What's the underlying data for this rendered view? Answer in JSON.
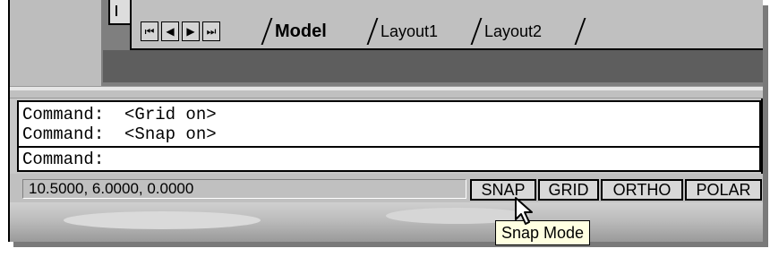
{
  "tabs": {
    "nav": [
      "⏮",
      "◀",
      "▶",
      "⏭"
    ],
    "items": [
      "Model",
      "Layout1",
      "Layout2"
    ],
    "active": "Model"
  },
  "command": {
    "lines": [
      "Command:  <Grid on>",
      "Command:  <Snap on>"
    ],
    "prompt": "Command:"
  },
  "status": {
    "coordinates": "10.5000, 6.0000, 0.0000",
    "buttons": [
      "SNAP",
      "GRID",
      "ORTHO",
      "POLAR"
    ]
  },
  "tooltip": "Snap Mode",
  "colors": {
    "tooltip_bg": "#ffffe1",
    "panel": "#c0c0c0",
    "dark": "#7f7f7f"
  }
}
